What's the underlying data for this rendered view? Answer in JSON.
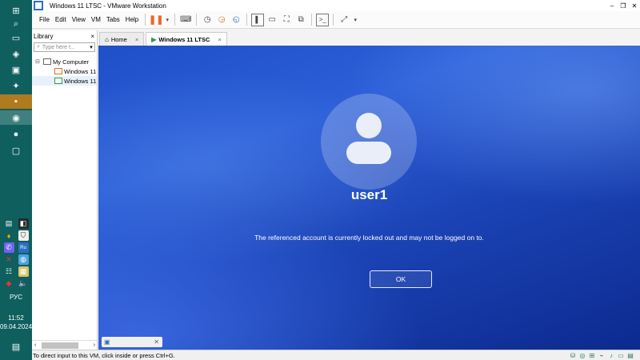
{
  "window": {
    "title": "Windows 11 LTSC - VMware Workstation"
  },
  "menu": [
    "File",
    "Edit",
    "View",
    "VM",
    "Tabs",
    "Help"
  ],
  "toolbar_icons": [
    "pause-icon",
    "dropdown-icon",
    "send-ctrl-alt-del-icon",
    "snapshot-icon",
    "revert-snapshot-icon",
    "manage-snapshots-icon",
    "show-library-icon",
    "thumbnail-bar-icon",
    "full-screen-icon",
    "unity-icon",
    "console-view-icon",
    "stretch-icon",
    "dropdown-icon"
  ],
  "library": {
    "title": "Library",
    "close": "×",
    "search_placeholder": "Type here t...",
    "tree": {
      "root": "My Computer",
      "items": [
        "Windows 11",
        "Windows 11"
      ]
    }
  },
  "tabs": [
    {
      "label": "Home",
      "close": "×"
    },
    {
      "label": "Windows 11 LTSC",
      "close": "×"
    }
  ],
  "vm_screen": {
    "username": "user1",
    "message": "The referenced account is currently locked out and may not be logged on to.",
    "ok_label": "OK"
  },
  "statusbar": {
    "text": "To direct input to this VM, click inside or press Ctrl+G."
  },
  "system_tray": {
    "language": "РУС",
    "time": "11:52",
    "date": "09.04.2024"
  },
  "colors": {
    "taskbar": "#0f5f5f",
    "vm_blue": "#1f4fc9",
    "pause_accent": "#f26522"
  }
}
